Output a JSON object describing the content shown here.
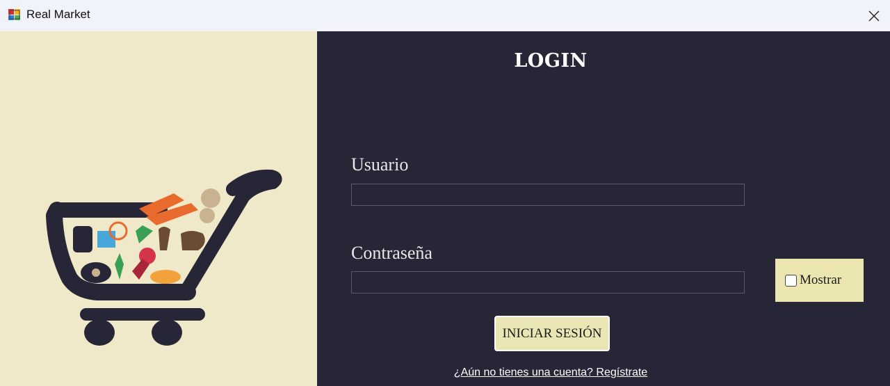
{
  "window": {
    "title": "Real Market",
    "close_icon": "close-icon"
  },
  "login": {
    "title": "LOGIN",
    "username_label": "Usuario",
    "username_value": "",
    "password_label": "Contraseña",
    "password_value": "",
    "show_label": "Mostrar",
    "show_checked": false,
    "submit_label": "INICIAR SESIÓN",
    "register_link": "¿Aún no tienes una cuenta? Regístrate"
  },
  "branding": {
    "logo": "shopping-cart-with-groceries"
  },
  "colors": {
    "dark_panel": "#272637",
    "light_panel": "#efe9c9",
    "accent": "#eae6b3",
    "cart": "#272637"
  }
}
